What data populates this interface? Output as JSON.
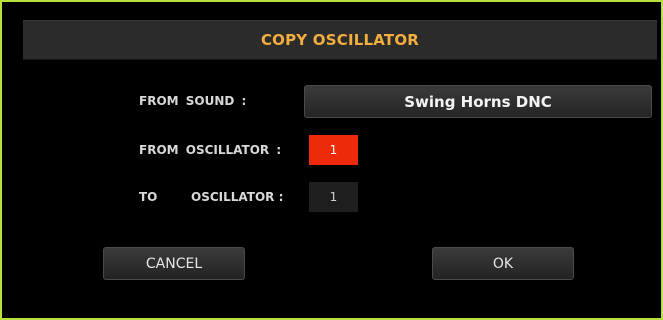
{
  "dialog": {
    "title": "COPY OSCILLATOR",
    "accent_color": "#b7e23d",
    "title_color": "#f2ae3e"
  },
  "form": {
    "from_sound_label": "FROM SOUND :",
    "from_sound_value": "Swing Horns DNC",
    "from_oscillator_label": "FROM OSCILLATOR :",
    "from_oscillator_value": "1",
    "from_oscillator_color": "#ee2a0b",
    "to_label": "TO",
    "to_oscillator_label": "OSCILLATOR :",
    "to_oscillator_value": "1"
  },
  "buttons": {
    "cancel_label": "CANCEL",
    "ok_label": "OK"
  }
}
